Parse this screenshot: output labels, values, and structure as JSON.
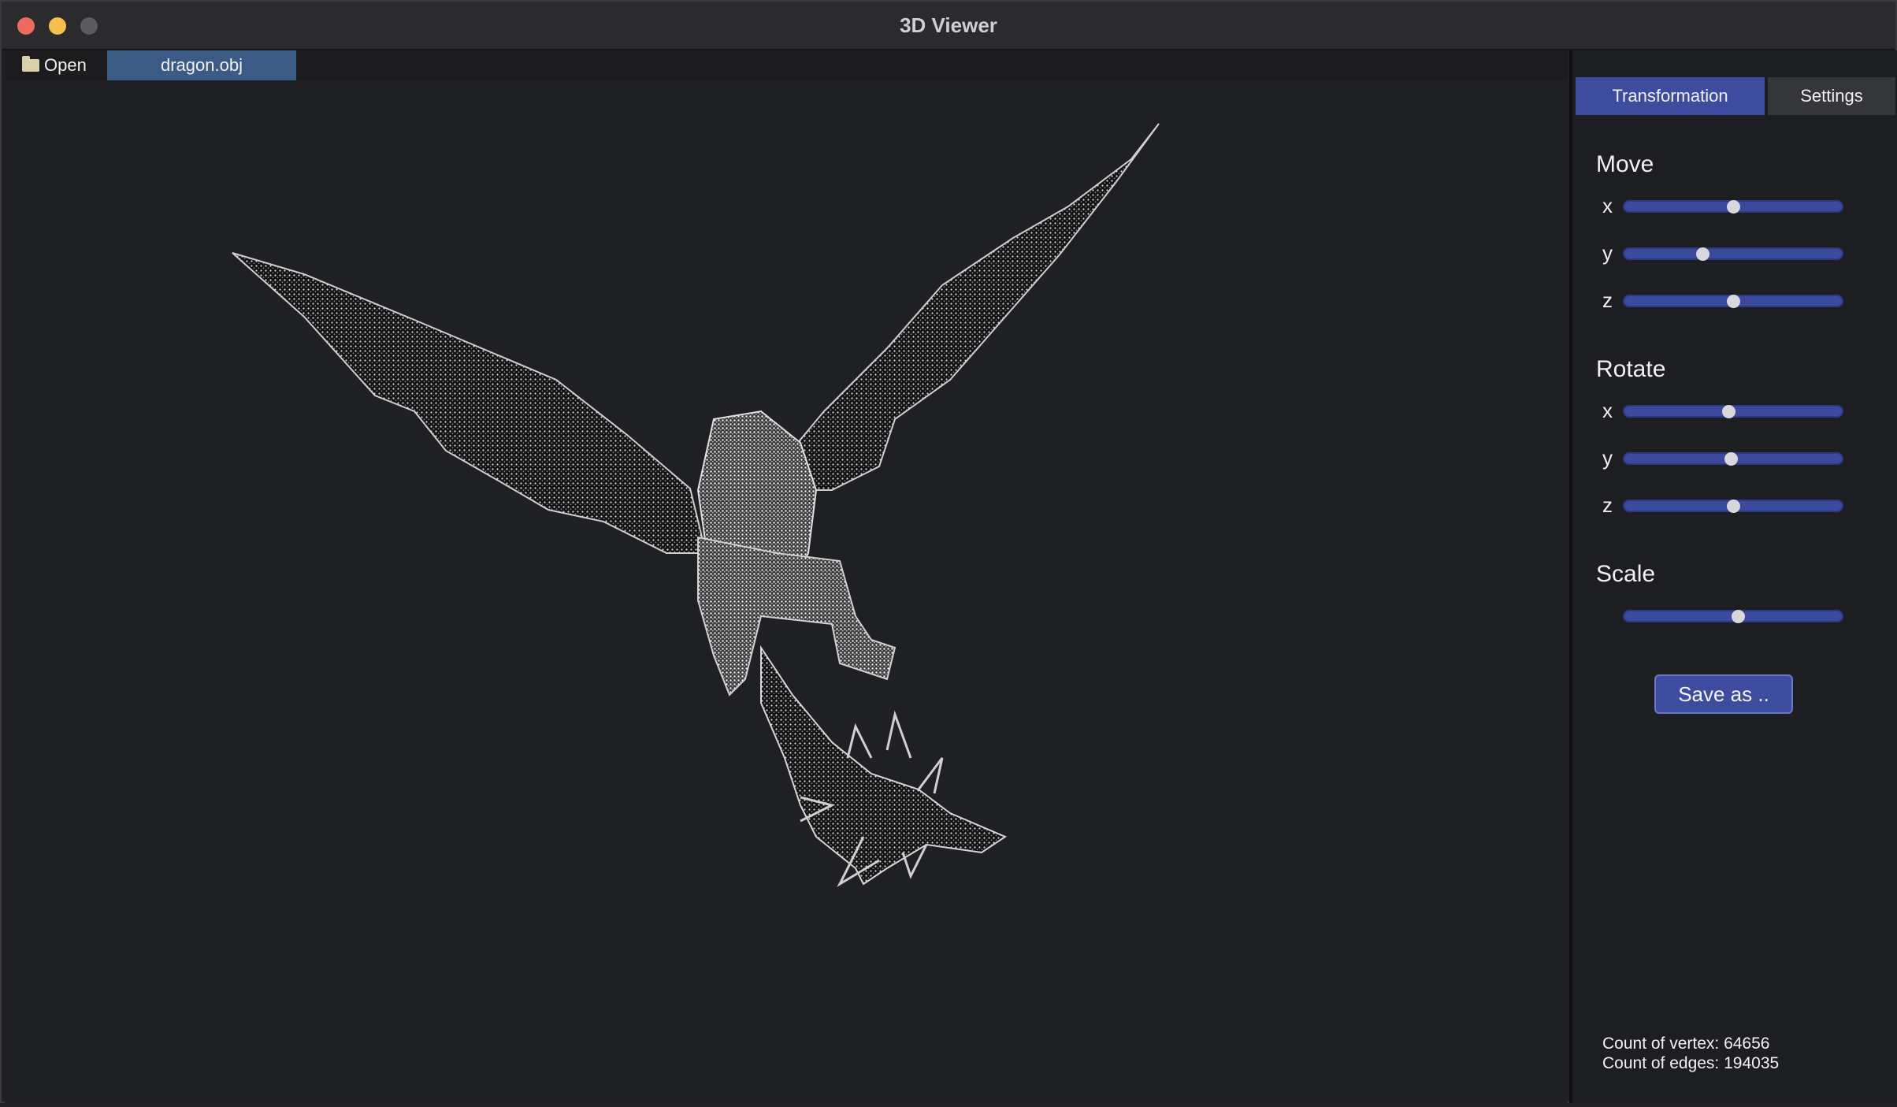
{
  "window": {
    "title": "3D Viewer"
  },
  "toolbar": {
    "open_label": "Open",
    "file_tab": "dragon.obj",
    "open_icon": "folder-icon"
  },
  "sidebar": {
    "tabs": [
      {
        "label": "Transformation",
        "active": true
      },
      {
        "label": "Settings",
        "active": false
      }
    ],
    "move": {
      "title": "Move",
      "axes": [
        {
          "label": "x",
          "value": 0.5
        },
        {
          "label": "y",
          "value": 0.36
        },
        {
          "label": "z",
          "value": 0.5
        }
      ]
    },
    "rotate": {
      "title": "Rotate",
      "axes": [
        {
          "label": "x",
          "value": 0.48
        },
        {
          "label": "y",
          "value": 0.49
        },
        {
          "label": "z",
          "value": 0.5
        }
      ]
    },
    "scale": {
      "title": "Scale",
      "value": 0.52
    },
    "save_label": "Save as ..",
    "stats": {
      "vertex": "Count of vertex: 64656",
      "edges": "Count of edges: 194035"
    }
  },
  "colors": {
    "accent": "#3d4c9e",
    "tab_file": "#3c5b84",
    "background": "#1f2023"
  }
}
